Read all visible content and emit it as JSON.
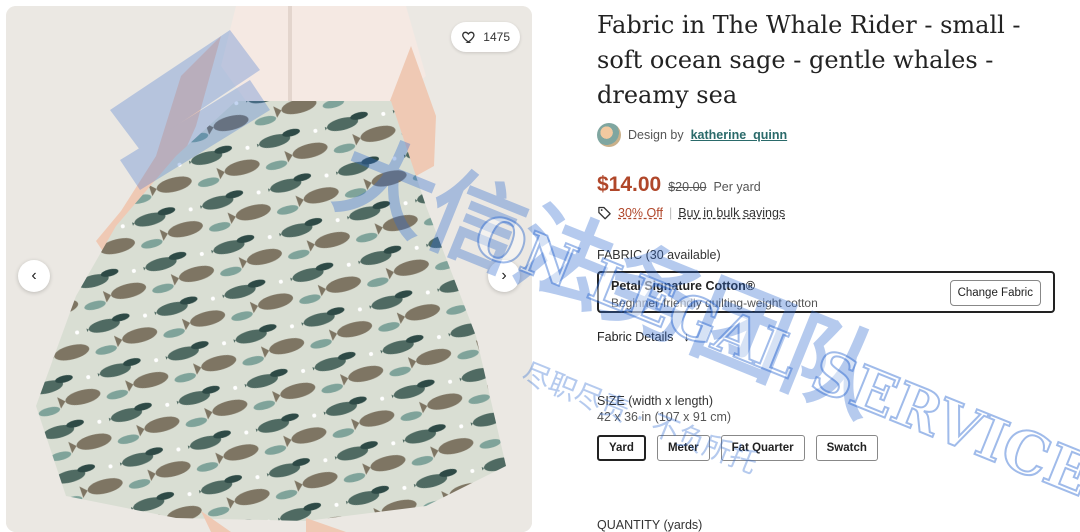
{
  "gallery": {
    "favorite_count": "1475",
    "prev_label": "‹",
    "next_label": "›"
  },
  "product": {
    "title": "Fabric in The Whale Rider - small - soft ocean sage - gentle whales - dreamy sea",
    "designer_prefix": "Design by",
    "designer_name": "katherine_quinn",
    "price": "$14.00",
    "old_price": "$20.00",
    "price_unit": "Per yard",
    "discount": "30% Off",
    "bulk_link": "Buy in bulk savings"
  },
  "fabric": {
    "label": "FABRIC (30 available)",
    "name": "Petal Signature Cotton®",
    "description": "Beginner-friendly quilting-weight cotton",
    "change_button": "Change Fabric",
    "details_link": "Fabric Details",
    "details_arrow": "↓"
  },
  "size": {
    "label": "SIZE (width x length)",
    "dimensions": "42 x 36 in (107 x 91 cm)",
    "options": [
      "Yard",
      "Meter",
      "Fat Quarter",
      "Swatch"
    ],
    "selected": "Yard"
  },
  "quantity": {
    "label": "QUANTITY (yards)"
  },
  "watermark": {
    "line1": "大信法务团队",
    "line2": "ON LEGAL SERVICE",
    "line3": "尽职尽责 · 不负所托"
  },
  "colors": {
    "price": "#b0472a",
    "link": "#2a6a6a",
    "fabric_bg": "#d9ded3",
    "watermark": "#2f6bd1"
  }
}
